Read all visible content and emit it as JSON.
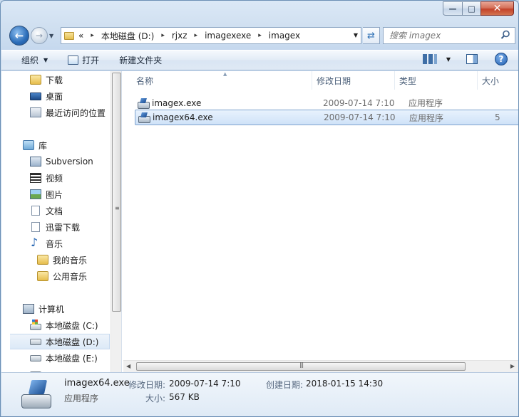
{
  "window": {
    "minimize": "—",
    "maximize": "□",
    "close": "✕"
  },
  "nav": {
    "back": "←",
    "forward": "→",
    "chevrons": "«",
    "breadcrumbs": [
      "本地磁盘 (D:)",
      "rjxz",
      "imagexexe",
      "imagex"
    ],
    "search_placeholder": "搜索 imagex"
  },
  "toolbar": {
    "organize": "组织",
    "open": "打开",
    "new_folder": "新建文件夹",
    "help": "?"
  },
  "sidebar": {
    "items": [
      {
        "label": "下载",
        "icon": "folder-icon"
      },
      {
        "label": "桌面",
        "icon": "desktop-icon"
      },
      {
        "label": "最近访问的位置",
        "icon": "recent-places-icon"
      },
      {
        "label": "库",
        "icon": "library-icon"
      },
      {
        "label": "Subversion",
        "icon": "subversion-icon"
      },
      {
        "label": "视频",
        "icon": "video-icon"
      },
      {
        "label": "图片",
        "icon": "pictures-icon"
      },
      {
        "label": "文档",
        "icon": "documents-icon"
      },
      {
        "label": "迅雷下载",
        "icon": "documents-icon"
      },
      {
        "label": "音乐",
        "icon": "music-icon"
      },
      {
        "label": "我的音乐",
        "icon": "folder-icon"
      },
      {
        "label": "公用音乐",
        "icon": "folder-icon"
      },
      {
        "label": "计算机",
        "icon": "computer-icon"
      },
      {
        "label": "本地磁盘 (C:)",
        "icon": "system-drive-icon"
      },
      {
        "label": "本地磁盘 (D:)",
        "icon": "drive-icon",
        "selected": true
      },
      {
        "label": "本地磁盘 (E:)",
        "icon": "drive-icon"
      }
    ]
  },
  "columns": {
    "name": "名称",
    "date": "修改日期",
    "type": "类型",
    "size": "大小"
  },
  "files": [
    {
      "name": "imagex.exe",
      "date": "2009-07-14 7:10",
      "type": "应用程序",
      "size": ""
    },
    {
      "name": "imagex64.exe",
      "date": "2009-07-14 7:10",
      "type": "应用程序",
      "size": "5",
      "selected": true
    }
  ],
  "details": {
    "name": "imagex64.exe",
    "type": "应用程序",
    "modified_label": "修改日期:",
    "modified_value": "2009-07-14 7:10",
    "created_label": "创建日期:",
    "created_value": "2018-01-15 14:30",
    "size_label": "大小:",
    "size_value": "567 KB"
  }
}
